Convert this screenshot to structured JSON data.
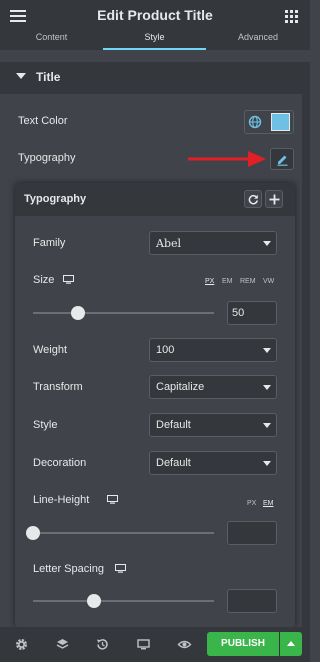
{
  "header": {
    "title": "Edit Product Title"
  },
  "tabs": [
    {
      "label": "Content"
    },
    {
      "label": "Style"
    },
    {
      "label": "Advanced"
    }
  ],
  "section": {
    "title": "Title"
  },
  "text_color": {
    "label": "Text Color",
    "swatch_color": "#6ec1e4"
  },
  "typography": {
    "label": "Typography"
  },
  "popover": {
    "title": "Typography",
    "family": {
      "label": "Family",
      "value": "Abel"
    },
    "size": {
      "label": "Size",
      "units": [
        "PX",
        "EM",
        "REM",
        "VW"
      ],
      "selected_unit": "PX",
      "value": "50",
      "slider_level": 0.25
    },
    "weight": {
      "label": "Weight",
      "value": "100"
    },
    "transform": {
      "label": "Transform",
      "value": "Capitalize"
    },
    "style": {
      "label": "Style",
      "value": "Default"
    },
    "decoration": {
      "label": "Decoration",
      "value": "Default"
    },
    "line_height": {
      "label": "Line-Height",
      "units": [
        "PX",
        "EM"
      ],
      "selected_unit": "EM",
      "value": "",
      "slider_level": 0.0
    },
    "letter_spacing": {
      "label": "Letter Spacing",
      "value": "",
      "slider_level": 0.33
    }
  },
  "footer": {
    "publish_label": "PUBLISH"
  },
  "colors": {
    "accent": "#71d7f7",
    "publish": "#39b54a",
    "arrow": "#e01f26"
  },
  "icons": [
    "hamburger-icon",
    "grid-icon",
    "globe-icon",
    "pencil-icon",
    "reset-icon",
    "plus-icon",
    "monitor-icon",
    "gear-icon",
    "layers-icon",
    "history-icon",
    "responsive-icon",
    "eye-icon",
    "caret-up-icon"
  ]
}
